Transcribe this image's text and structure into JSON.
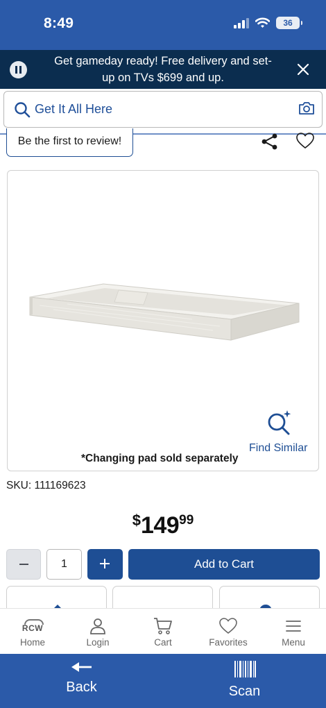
{
  "status_bar": {
    "time": "8:49",
    "battery": "36"
  },
  "promo": {
    "text": "Get gameday ready! Free delivery and set-up on TVs $699 and up."
  },
  "search": {
    "placeholder": "Get It All Here"
  },
  "product": {
    "review_link": "Be the first to review!",
    "find_similar": "Find Similar",
    "image_caption": "*Changing pad sold separately",
    "sku": "SKU: 111169623",
    "price": {
      "currency": "$",
      "dollars": "149",
      "cents": "99"
    }
  },
  "cart": {
    "quantity": "1",
    "add_label": "Add to Cart"
  },
  "bottom_nav": {
    "items": [
      {
        "label": "Home",
        "icon": "rcw-logo-icon"
      },
      {
        "label": "Login",
        "icon": "user-icon"
      },
      {
        "label": "Cart",
        "icon": "cart-icon"
      },
      {
        "label": "Favorites",
        "icon": "heart-icon"
      },
      {
        "label": "Menu",
        "icon": "hamburger-icon"
      }
    ]
  },
  "browser_bar": {
    "back_label": "Back",
    "scan_label": "Scan"
  },
  "colors": {
    "brand_blue": "#1e4e94",
    "header_blue": "#2b5aa9",
    "promo_navy": "#0b2d4f"
  }
}
